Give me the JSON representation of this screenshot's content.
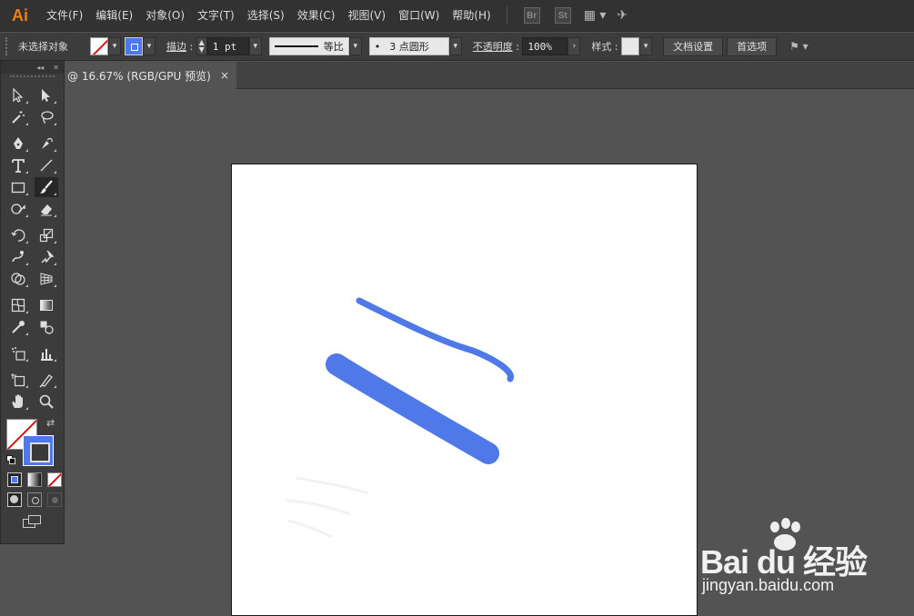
{
  "app": {
    "logo": "Ai",
    "accent": "#e8830f"
  },
  "menu": [
    "文件(F)",
    "编辑(E)",
    "对象(O)",
    "文字(T)",
    "选择(S)",
    "效果(C)",
    "视图(V)",
    "窗口(W)",
    "帮助(H)"
  ],
  "menubar_icons": {
    "bridge": "Br",
    "stock": "St"
  },
  "control": {
    "selection_status": "未选择对象",
    "stroke_label": "描边",
    "stroke_weight": "1 pt",
    "stroke_profile": "等比",
    "brush": "3 点圆形",
    "opacity_label": "不透明度",
    "opacity_value": "100%",
    "style_label": "样式",
    "doc_setup_button": "文档设置",
    "prefs_button": "首选项"
  },
  "document_tab": {
    "title": "@ 16.67% (RGB/GPU 预览)",
    "close": "×"
  },
  "colors": {
    "stroke_color": "#4f79e9",
    "fill": "none"
  },
  "watermark": {
    "brand": "Bai du 经验",
    "url": "jingyan.baidu.com"
  }
}
